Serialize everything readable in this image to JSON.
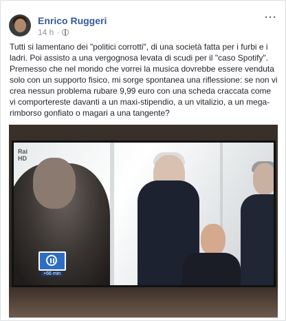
{
  "post": {
    "author": "Enrico Ruggeri",
    "timestamp": "14 h",
    "privacy_icon": "globe-icon",
    "more_icon": "ellipsis-icon",
    "more_label": "···",
    "paragraphs": [
      "Tutti si lamentano dei \"politici corrotti\", di una società fatta per i furbi e i ladri. Poi assisto a una vergognosa levata di scudi per il \"caso Spotify\".",
      "Premesso che nel mondo che vorrei la musica dovrebbe essere venduta solo con un supporto fisico, mi sorge spontanea una riflessione: se non vi crea nessun problema rubare 9,99 euro con una scheda craccata come vi comportereste davanti a un maxi-stipendio, a un vitalizio, a un mega-rimborso gonfiato o magari a una tangente?"
    ]
  },
  "photo": {
    "tv_logo": "Rai",
    "tv_logo_line2": "HD",
    "badge_label": "+66 min"
  }
}
